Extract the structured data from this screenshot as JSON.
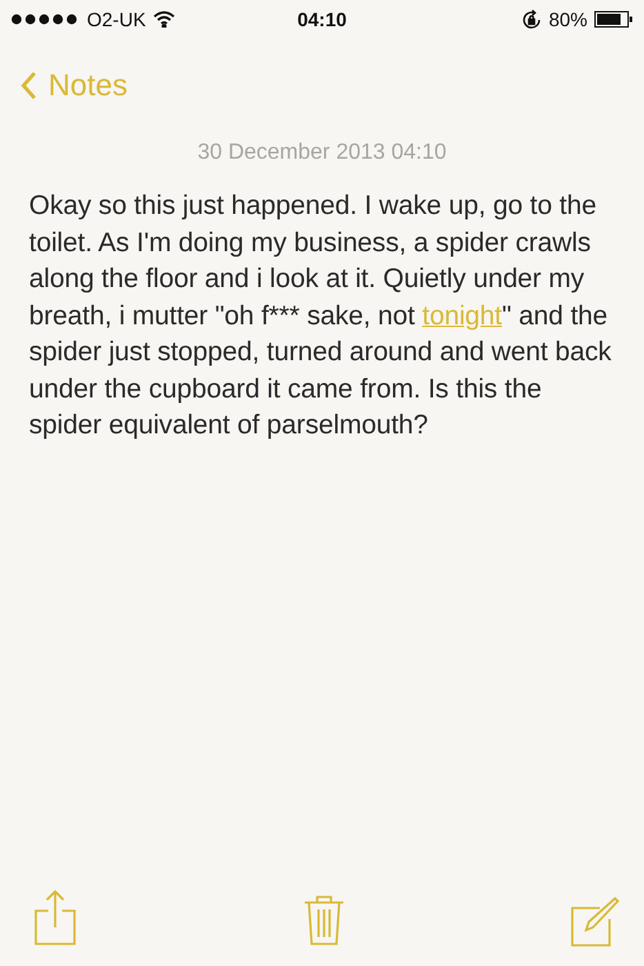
{
  "status_bar": {
    "carrier": "O2-UK",
    "time": "04:10",
    "battery": "80%"
  },
  "nav": {
    "back": "Notes"
  },
  "note": {
    "date": "30 December 2013 04:10",
    "body": [
      {
        "kind": "text",
        "text": "Okay so this just happened. I wake up, go to the toilet. As I'm doing my business, a spider crawls along the floor and i look at it. Quietly under my breath, i mutter \"oh f*** sake, not "
      },
      {
        "kind": "link",
        "text": "tonight"
      },
      {
        "kind": "text",
        "text": "\" and the spider just stopped, turned around and went back under the cupboard it came from. Is this the spider equivalent of parselmouth?"
      }
    ]
  },
  "toolbar": [
    {
      "kind": "share"
    },
    {
      "kind": "trash"
    },
    {
      "kind": "compose"
    }
  ]
}
